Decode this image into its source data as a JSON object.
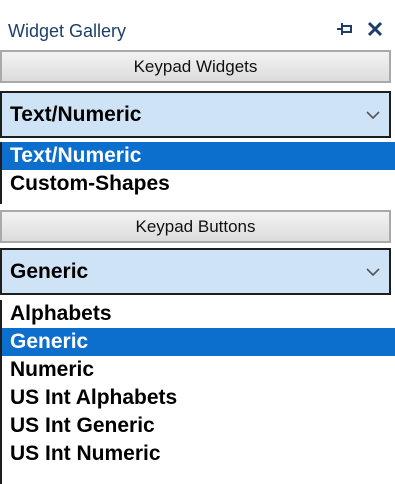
{
  "title": {
    "text": "Widget Gallery",
    "pin_icon": "pin-icon",
    "close_icon": "close-icon"
  },
  "keypad_widgets": {
    "header_label": "Keypad Widgets",
    "selected_value": "Text/Numeric",
    "options": [
      "Text/Numeric",
      "Custom-Shapes"
    ],
    "selected_index": 0
  },
  "keypad_buttons": {
    "header_label": "Keypad Buttons",
    "selected_value": "Generic",
    "options": [
      "Alphabets",
      "Generic",
      "Numeric",
      "US Int Alphabets",
      "US Int Generic",
      "US Int Numeric"
    ],
    "selected_index": 1
  },
  "colors": {
    "title_text": "#1e3e6a",
    "combo_bg": "#cfe3f7",
    "selection": "#0c6fcd",
    "header_bg": "#e6e6e6"
  }
}
